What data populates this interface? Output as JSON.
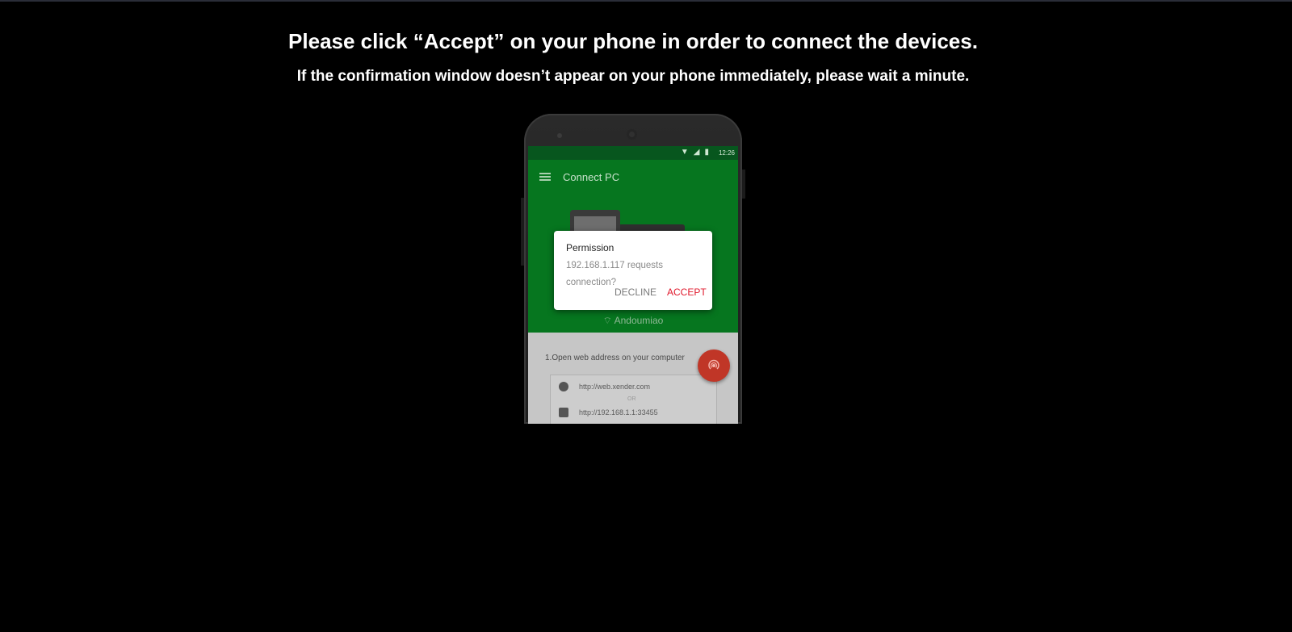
{
  "page": {
    "heading": "Please click “Accept” on your phone in order to connect the devices.",
    "subheading": "If the confirmation window doesn’t appear on your phone immediately, please wait a minute."
  },
  "phone": {
    "status_time": "12:26",
    "app_title": "Connect PC",
    "hotspot_name": "Andoumiao",
    "step_text": "1.Open web address on your computer",
    "urls": [
      "http://web.xender.com",
      "http://192.168.1.1:33455"
    ],
    "or_text": "OR"
  },
  "dialog": {
    "title": "Permission",
    "message": "192.168.1.117 requests connection?",
    "decline_label": "DECLINE",
    "accept_label": "ACCEPT"
  },
  "colors": {
    "background": "#000000",
    "app_green": "#06761f",
    "accept_red": "#e0192c",
    "fab_red": "#c03627"
  }
}
